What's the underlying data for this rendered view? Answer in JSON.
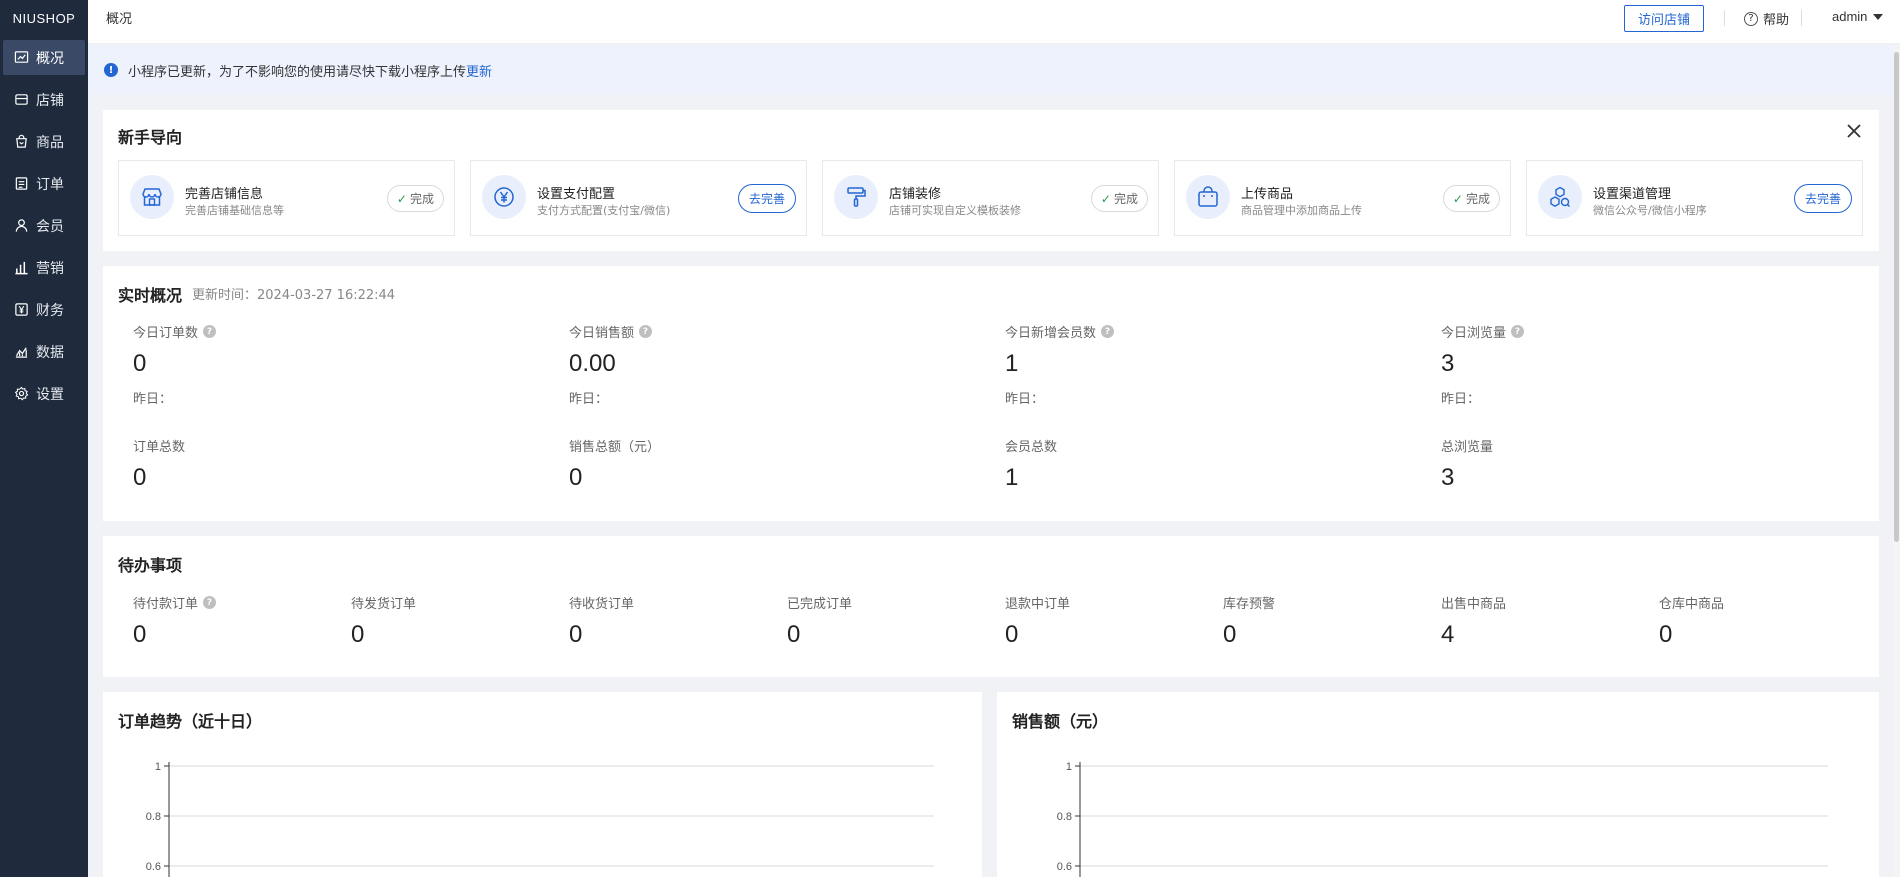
{
  "app": {
    "logo": "NIUSHOP"
  },
  "sidebar": {
    "items": [
      {
        "label": "概况",
        "icon": "chart-line-icon",
        "active": true
      },
      {
        "label": "店铺",
        "icon": "store-icon",
        "active": false
      },
      {
        "label": "商品",
        "icon": "bag-icon",
        "active": false
      },
      {
        "label": "订单",
        "icon": "order-list-icon",
        "active": false
      },
      {
        "label": "会员",
        "icon": "user-icon",
        "active": false
      },
      {
        "label": "营销",
        "icon": "bar-chart-icon",
        "active": false
      },
      {
        "label": "财务",
        "icon": "yen-icon",
        "active": false
      },
      {
        "label": "数据",
        "icon": "data-chart-icon",
        "active": false
      },
      {
        "label": "设置",
        "icon": "gear-icon",
        "active": false
      }
    ]
  },
  "header": {
    "breadcrumb": "概况",
    "visit_store": "访问店铺",
    "help": "帮助",
    "user": "admin"
  },
  "notice": {
    "text": "小程序已更新，为了不影响您的使用请尽快下载小程序上传",
    "link": "更新"
  },
  "guide": {
    "title": "新手导向",
    "cards": [
      {
        "title": "完善店铺信息",
        "desc": "完善店铺基础信息等",
        "status": "完成",
        "done": true,
        "icon": "store-icon"
      },
      {
        "title": "设置支付配置",
        "desc": "支付方式配置(支付宝/微信)",
        "status": "去完善",
        "done": false,
        "icon": "yen-circle-icon"
      },
      {
        "title": "店铺装修",
        "desc": "店铺可实现自定义模板装修",
        "status": "完成",
        "done": true,
        "icon": "paint-roller-icon"
      },
      {
        "title": "上传商品",
        "desc": "商品管理中添加商品上传",
        "status": "完成",
        "done": true,
        "icon": "shopping-bag-icon"
      },
      {
        "title": "设置渠道管理",
        "desc": "微信公众号/微信小程序",
        "status": "去完善",
        "done": false,
        "icon": "channels-icon"
      }
    ]
  },
  "realtime": {
    "title": "实时概况",
    "updated": "更新时间：2024-03-27 16:22:44",
    "yesterday_label": "昨日：",
    "today": [
      {
        "label": "今日订单数",
        "value": "0"
      },
      {
        "label": "今日销售额",
        "value": "0.00"
      },
      {
        "label": "今日新增会员数",
        "value": "1"
      },
      {
        "label": "今日浏览量",
        "value": "3"
      }
    ],
    "totals": [
      {
        "label": "订单总数",
        "value": "0"
      },
      {
        "label": "销售总额（元）",
        "value": "0"
      },
      {
        "label": "会员总数",
        "value": "1"
      },
      {
        "label": "总浏览量",
        "value": "3"
      }
    ]
  },
  "todo": {
    "title": "待办事项",
    "items": [
      {
        "label": "待付款订单",
        "value": "0",
        "help": true
      },
      {
        "label": "待发货订单",
        "value": "0",
        "help": false
      },
      {
        "label": "待收货订单",
        "value": "0",
        "help": false
      },
      {
        "label": "已完成订单",
        "value": "0",
        "help": false
      },
      {
        "label": "退款中订单",
        "value": "0",
        "help": false
      },
      {
        "label": "库存预警",
        "value": "0",
        "help": false
      },
      {
        "label": "出售中商品",
        "value": "4",
        "help": false
      },
      {
        "label": "仓库中商品",
        "value": "0",
        "help": false
      }
    ]
  },
  "chart_data": [
    {
      "type": "line",
      "title": "订单趋势（近十日）",
      "y_ticks": [
        "1",
        "0.8",
        "0.6"
      ],
      "ylim_visible": [
        0.6,
        1
      ]
    },
    {
      "type": "line",
      "title": "销售额（元）",
      "y_ticks": [
        "1",
        "0.8",
        "0.6"
      ],
      "ylim_visible": [
        0.6,
        1
      ]
    }
  ]
}
